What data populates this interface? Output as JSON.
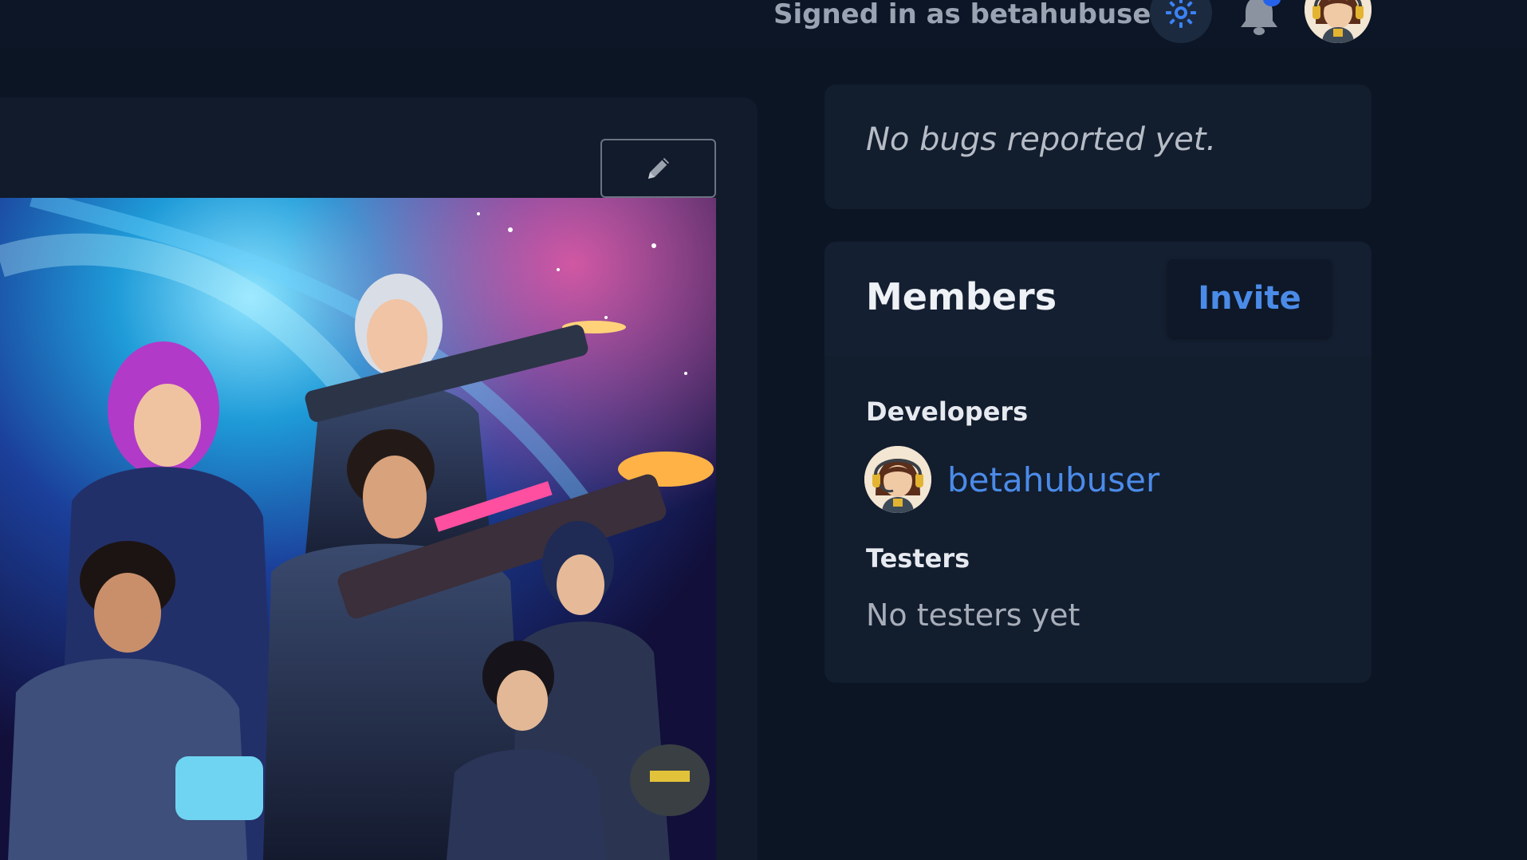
{
  "header": {
    "signed_in_text": "Signed in as betahubuser",
    "theme_icon": "sun-icon",
    "notification_icon": "bell-icon",
    "avatar_icon": "user-avatar"
  },
  "project": {
    "edit_icon": "pencil-icon",
    "cover_image": "game-cover-art"
  },
  "bugs": {
    "empty_text": "No bugs reported yet."
  },
  "members": {
    "title": "Members",
    "invite_label": "Invite",
    "developers_label": "Developers",
    "developers": [
      {
        "name": "betahubuser"
      }
    ],
    "testers_label": "Testers",
    "testers_empty_text": "No testers yet"
  },
  "colors": {
    "background": "#0c1524",
    "card": "#121d2e",
    "accent": "#4b8be8",
    "notification_dot": "#2563eb"
  }
}
